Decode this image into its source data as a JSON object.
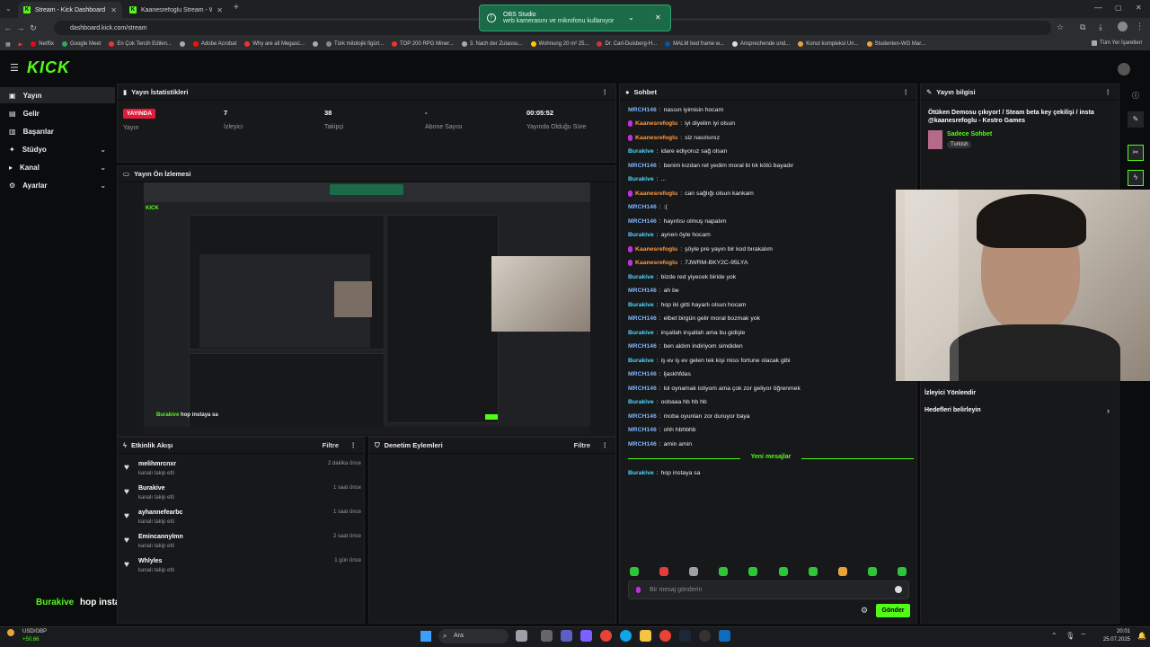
{
  "browser": {
    "tabs": [
      {
        "label": "Stream - Kick Dashboard"
      },
      {
        "label": "Kaanesrefoglu Stream - Watch"
      }
    ],
    "url": "dashboard.kick.com/stream",
    "bookmarks": [
      "Netflix",
      "Google Meet",
      "En Çok Tercih Edilen...",
      "Adobe Acrobat",
      "Why are all Megasc...",
      "Türk mitolojik figürl...",
      "TOP 200 RPG Miner...",
      "3. Nach der Zulassu...",
      "Wohnung 20 m² 25...",
      "Dr. Carl-Duisberg-H...",
      "MALM bed frame w...",
      "Ansprechende und...",
      "Konut kompleksi Un...",
      "Studenten-WG Mar...",
      "Tüm Yer İşaretleri"
    ]
  },
  "notification": {
    "title": "OBS Studio",
    "text": "web kamerasını ve mikrofonu kullanıyor"
  },
  "brand": {
    "logo": "KICK",
    "accent": "#53fc18"
  },
  "sidebar": {
    "items": [
      {
        "label": "Yayın",
        "icon": "video-icon",
        "active": true
      },
      {
        "label": "Gelir",
        "icon": "dollar-icon"
      },
      {
        "label": "Başarılar",
        "icon": "trophy-icon"
      },
      {
        "label": "Stüdyo",
        "icon": "studio-icon",
        "expand": true
      },
      {
        "label": "Kanal",
        "icon": "channel-icon",
        "expand": true
      },
      {
        "label": "Ayarlar",
        "icon": "gear-icon",
        "expand": true
      }
    ]
  },
  "stats": {
    "title": "Yayın İstatistikleri",
    "live_badge": "YAYINDA",
    "items": [
      {
        "value": "",
        "label": "Yayın"
      },
      {
        "value": "7",
        "label": "İzleyici"
      },
      {
        "value": "38",
        "label": "Takipçi"
      },
      {
        "value": "-",
        "label": "Abone Sayısı"
      },
      {
        "value": "00:05:52",
        "label": "Yayında Olduğu Süre"
      }
    ]
  },
  "preview": {
    "title": "Yayın Ön İzlemesi"
  },
  "overlay_chat": {
    "user": "Burakive",
    "text": "hop instaya sa"
  },
  "activity": {
    "title": "Etkinlik Akışı",
    "filter": "Filtre",
    "items": [
      {
        "name": "melihmrcnxr",
        "sub": "kanalı takip etti",
        "time": "2 dakika önce"
      },
      {
        "name": "Burakive",
        "sub": "kanalı takip etti",
        "time": "1 saat önce"
      },
      {
        "name": "ayhannefearbc",
        "sub": "kanalı takip etti",
        "time": "1 saat önce"
      },
      {
        "name": "Emincannylmn",
        "sub": "kanalı takip etti",
        "time": "2 saat önce"
      },
      {
        "name": "Whlyles",
        "sub": "kanalı takip etti",
        "time": "1 gün önce"
      }
    ]
  },
  "moderation": {
    "title": "Denetim Eylemleri",
    "filter": "Filtre"
  },
  "chat": {
    "title": "Sohbet",
    "messages": [
      {
        "user": "MRCH146",
        "text": "nassın iyimisin hocam",
        "color": "#7fb3ff"
      },
      {
        "user": "Kaanesrefoglu",
        "text": "iyi diyelim iyi olsun",
        "color": "#ff9a3c",
        "mic": true
      },
      {
        "user": "Kaanesrefoglu",
        "text": "siz nasılsınız",
        "color": "#ff9a3c",
        "mic": true
      },
      {
        "user": "Burakive",
        "text": "idare ediyoruz sağ olsan",
        "color": "#4fd6ff"
      },
      {
        "user": "MRCH146",
        "text": "benim kızdan ret yedim moral bi tık kötü bayadır",
        "color": "#7fb3ff"
      },
      {
        "user": "Burakive",
        "text": "...",
        "color": "#4fd6ff"
      },
      {
        "user": "Kaanesrefoglu",
        "text": "can sağlığı olsun kankam",
        "color": "#ff9a3c",
        "mic": true
      },
      {
        "user": "MRCH146",
        "text": ":(",
        "color": "#7fb3ff"
      },
      {
        "user": "MRCH146",
        "text": "hayırlısı olmuş napalım",
        "color": "#7fb3ff"
      },
      {
        "user": "Burakive",
        "text": "aynen öyle hocam",
        "color": "#4fd6ff"
      },
      {
        "user": "Kaanesrefoglu",
        "text": "şöyle pre yayın bir kod bırakalım",
        "color": "#ff9a3c",
        "mic": true
      },
      {
        "user": "Kaanesrefoglu",
        "text": "7JWRM-BKY2C-95LYA",
        "color": "#ff9a3c",
        "mic": true
      },
      {
        "user": "Burakive",
        "text": "bizde red yiyecek biride yok",
        "color": "#4fd6ff"
      },
      {
        "user": "MRCH146",
        "text": "ah be",
        "color": "#7fb3ff"
      },
      {
        "user": "Burakive",
        "text": "hop iki gitti hayarlı olsun hocam",
        "color": "#4fd6ff"
      },
      {
        "user": "MRCH146",
        "text": "elbet birgün gelir moral bozmak yok",
        "color": "#7fb3ff"
      },
      {
        "user": "Burakive",
        "text": "inşallah inşallah ama bu gidişle",
        "color": "#4fd6ff"
      },
      {
        "user": "MRCH146",
        "text": "ben aldım indiriyom simdiden",
        "color": "#7fb3ff"
      },
      {
        "user": "Burakive",
        "text": "iş ev iş ev gelen tek kişi miss fortune olacak gibi",
        "color": "#4fd6ff"
      },
      {
        "user": "MRCH146",
        "text": "ljaskhfdas",
        "color": "#7fb3ff"
      },
      {
        "user": "MRCH146",
        "text": "lol oynamak istiyom ama çok zor geliyor öğrenmek",
        "color": "#7fb3ff"
      },
      {
        "user": "Burakive",
        "text": "oobaaa hb hb hb",
        "color": "#4fd6ff"
      },
      {
        "user": "MRCH146",
        "text": "moba oyunları zor duruyor baya",
        "color": "#7fb3ff"
      },
      {
        "user": "MRCH146",
        "text": "ohh hbhbhb",
        "color": "#7fb3ff"
      },
      {
        "user": "MRCH146",
        "text": "amin amin",
        "color": "#7fb3ff"
      }
    ],
    "new_messages_label": "Yeni mesajlar",
    "new_message": {
      "user": "Burakive",
      "text": "hop instaya sa",
      "color": "#4fd6ff"
    },
    "input_placeholder": "Bir mesaj gönderin",
    "send_label": "Gönder"
  },
  "stream_info": {
    "title": "Yayın bilgisi",
    "stream_title": "Ötüken Demosu çıkıyor! / Steam beta key çekilişi / insta @kaanesrefoglu - Kestro Games",
    "category": "Sadece Sohbet",
    "language": "Turkish"
  },
  "viewer_redirect": {
    "title": "İzleyici Yönlendir",
    "goal": "Hedefleri belirleyin"
  },
  "taskbar": {
    "ticker": "USD/GBP",
    "ticker_change": "+50,66",
    "search": "Ara",
    "time": "20:01",
    "date": "25.07.2025"
  }
}
